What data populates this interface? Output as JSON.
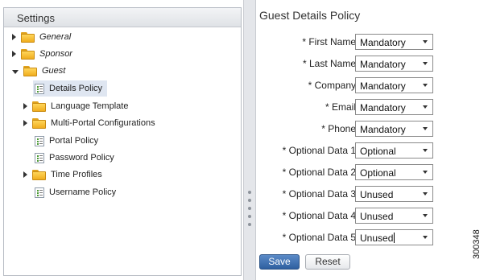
{
  "sidebar": {
    "title": "Settings",
    "items": [
      {
        "label": "General",
        "type": "folder",
        "expander": "right",
        "italic": true
      },
      {
        "label": "Sponsor",
        "type": "folder",
        "expander": "right",
        "italic": true
      },
      {
        "label": "Guest",
        "type": "folder",
        "expander": "down",
        "italic": true
      },
      {
        "label": "Details Policy",
        "type": "doc",
        "selected": true
      },
      {
        "label": "Language Template",
        "type": "folder",
        "expander": "right"
      },
      {
        "label": "Multi-Portal Configurations",
        "type": "folder",
        "expander": "right"
      },
      {
        "label": "Portal Policy",
        "type": "doc"
      },
      {
        "label": "Password Policy",
        "type": "doc"
      },
      {
        "label": "Time Profiles",
        "type": "folder",
        "expander": "right"
      },
      {
        "label": "Username Policy",
        "type": "doc"
      }
    ]
  },
  "form": {
    "title": "Guest Details Policy",
    "fields": [
      {
        "label": "* First Name",
        "value": "Mandatory"
      },
      {
        "label": "* Last Name",
        "value": "Mandatory"
      },
      {
        "label": "* Company",
        "value": "Mandatory"
      },
      {
        "label": "* Email",
        "value": "Mandatory"
      },
      {
        "label": "* Phone",
        "value": "Mandatory"
      },
      {
        "label": "* Optional Data 1",
        "value": "Optional"
      },
      {
        "label": "* Optional Data 2",
        "value": "Optional"
      },
      {
        "label": "* Optional Data 3",
        "value": "Unused"
      },
      {
        "label": "* Optional Data 4",
        "value": "Unused"
      },
      {
        "label": "* Optional Data 5",
        "value": "Unused"
      }
    ],
    "save_label": "Save",
    "reset_label": "Reset"
  },
  "figure_id": "300348",
  "colors": {
    "save_button": "#3a6aab",
    "folder": "#f5b83a",
    "selection": "#dfe6f1"
  }
}
